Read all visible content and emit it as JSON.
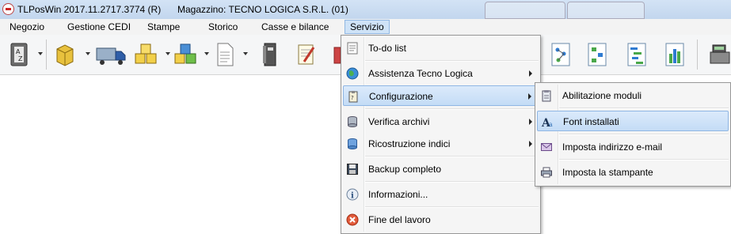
{
  "window": {
    "title": "TLPosWin 2017.11.2717.3774 (R)",
    "warehouse": "Magazzino: TECNO LOGICA S.R.L. (01)"
  },
  "menubar": [
    "Negozio",
    "Gestione CEDI",
    "Stampe",
    "Storico",
    "Casse e bilance",
    "Servizio"
  ],
  "servizio_menu": [
    {
      "label": "To-do list",
      "icon": "todo-list-icon",
      "submenu": false
    },
    {
      "label": "Assistenza Tecno Logica",
      "icon": "globe-icon",
      "submenu": true
    },
    {
      "label": "Configurazione",
      "icon": "clipboard-icon",
      "submenu": true,
      "highlighted": true
    },
    {
      "label": "Verifica archivi",
      "icon": "database-icon",
      "submenu": true
    },
    {
      "label": "Ricostruzione indici",
      "icon": "database-refresh-icon",
      "submenu": true
    },
    {
      "label": "Backup completo",
      "icon": "floppy-disk-icon",
      "submenu": false
    },
    {
      "label": "Informazioni...",
      "icon": "info-icon",
      "submenu": false
    },
    {
      "label": "Fine del lavoro",
      "icon": "exit-icon",
      "submenu": false
    }
  ],
  "configurazione_menu": [
    {
      "label": "Abilitazione moduli",
      "icon": "modules-icon"
    },
    {
      "label": "Font installati",
      "icon": "font-icon",
      "highlighted": true
    },
    {
      "label": "Imposta indirizzo e-mail",
      "icon": "email-icon"
    },
    {
      "label": "Imposta la stampante",
      "icon": "printer-icon"
    }
  ]
}
